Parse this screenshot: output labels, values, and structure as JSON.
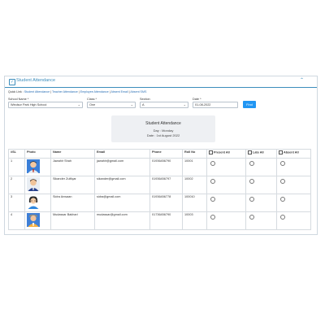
{
  "panel": {
    "title": "Student Attendance",
    "collapse_icon": "chevron-up-icon",
    "accent": "#3c8dbc"
  },
  "quick": {
    "prefix": "Quick Link : ",
    "links": [
      "Student Attendance",
      "Teacher Attendance",
      "Employee Attendance",
      "Absent Email",
      "Absent SMS"
    ]
  },
  "filters": {
    "school": {
      "label": "School Name *",
      "value": "Windsor Park High School"
    },
    "class": {
      "label": "Class *",
      "value": "One"
    },
    "section": {
      "label": "Section",
      "value": "A"
    },
    "date": {
      "label": "Date *",
      "value": "01-08-2022"
    },
    "find": "Find"
  },
  "info": {
    "title": "Student Attendance",
    "day": "Day : Monday",
    "date": "Date : 1st August 2022"
  },
  "table": {
    "headers": [
      "#SL",
      "Photo",
      "Name",
      "Email",
      "Phone",
      "Roll No",
      "Present All",
      "Late All",
      "Absent All"
    ],
    "rows": [
      {
        "sl": "1",
        "name": "Jawahir Shah",
        "email": "jawahir@gmail.com",
        "phone": "01936456790",
        "roll": "10001"
      },
      {
        "sl": "2",
        "name": "Sikander Zulfiqar",
        "email": "sikander@gmail.com",
        "phone": "01936456797",
        "roll": "10002"
      },
      {
        "sl": "3",
        "name": "Sidra Anwaan",
        "email": "sidra@gmail.com",
        "phone": "01936456778",
        "roll": "100010"
      },
      {
        "sl": "4",
        "name": "Mudassar Bakhari",
        "email": "mudassar@gmail.com",
        "phone": "01736456790",
        "roll": "10003"
      }
    ]
  }
}
